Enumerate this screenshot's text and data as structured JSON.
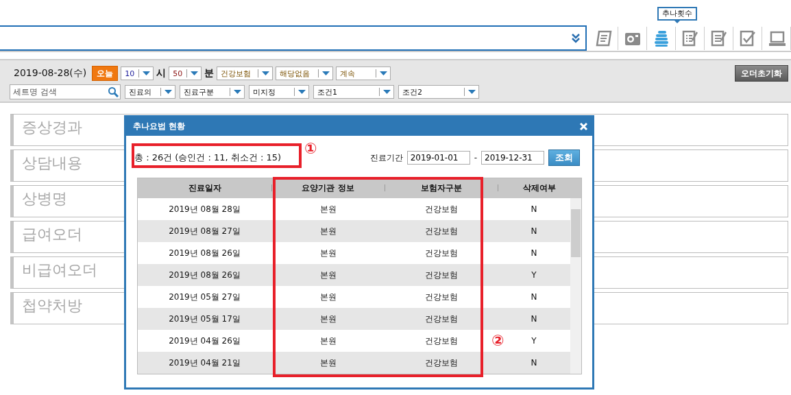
{
  "tooltip": "추나횟수",
  "toolbar": [
    {
      "kind": "scroll",
      "selected": false
    },
    {
      "kind": "camera",
      "selected": false
    },
    {
      "kind": "spine",
      "selected": true
    },
    {
      "kind": "checklist",
      "selected": false
    },
    {
      "kind": "notes",
      "selected": false
    },
    {
      "kind": "check",
      "selected": false
    },
    {
      "kind": "monitor",
      "selected": false
    }
  ],
  "filters": {
    "date": "2019-08-28(수)",
    "today_button": "오늘",
    "hour": "10",
    "hour_unit": "시",
    "minute": "50",
    "minute_unit": "분",
    "insurance": "건강보험",
    "status": "해당없음",
    "continue": "계속",
    "reset_button": "오더초기화",
    "search_placeholder": "세트명 검색",
    "selects": [
      "진료의",
      "진료구분",
      "미지정",
      "조건1",
      "조건2"
    ]
  },
  "sections": [
    "증상경과",
    "상담내용",
    "상병명",
    "급여오더",
    "비급여오더",
    "첩약처방"
  ],
  "dialog": {
    "title": "추나요법 현황",
    "summary": "총 : 26건 (승인건 : 11, 취소건 : 15)",
    "period_label": "진료기간",
    "date_from": "2019-01-01",
    "date_sep": "-",
    "date_to": "2019-12-31",
    "search_button": "조회",
    "columns": [
      "진료일자",
      "요양기관 정보",
      "보험자구분",
      "삭제여부"
    ],
    "rows": [
      [
        "2019년 08월 28일",
        "본원",
        "건강보험",
        "N"
      ],
      [
        "2019년 08월 27일",
        "본원",
        "건강보험",
        "N"
      ],
      [
        "2019년 08월 26일",
        "본원",
        "건강보험",
        "N"
      ],
      [
        "2019년 08월 26일",
        "본원",
        "건강보험",
        "Y"
      ],
      [
        "2019년 05월 27일",
        "본원",
        "건강보험",
        "N"
      ],
      [
        "2019년 05월 17일",
        "본원",
        "건강보험",
        "N"
      ],
      [
        "2019년 04월 26일",
        "본원",
        "건강보험",
        "Y"
      ],
      [
        "2019년 04월 21일",
        "본원",
        "건강보험",
        "N"
      ]
    ],
    "markers": [
      "①",
      "②"
    ]
  }
}
